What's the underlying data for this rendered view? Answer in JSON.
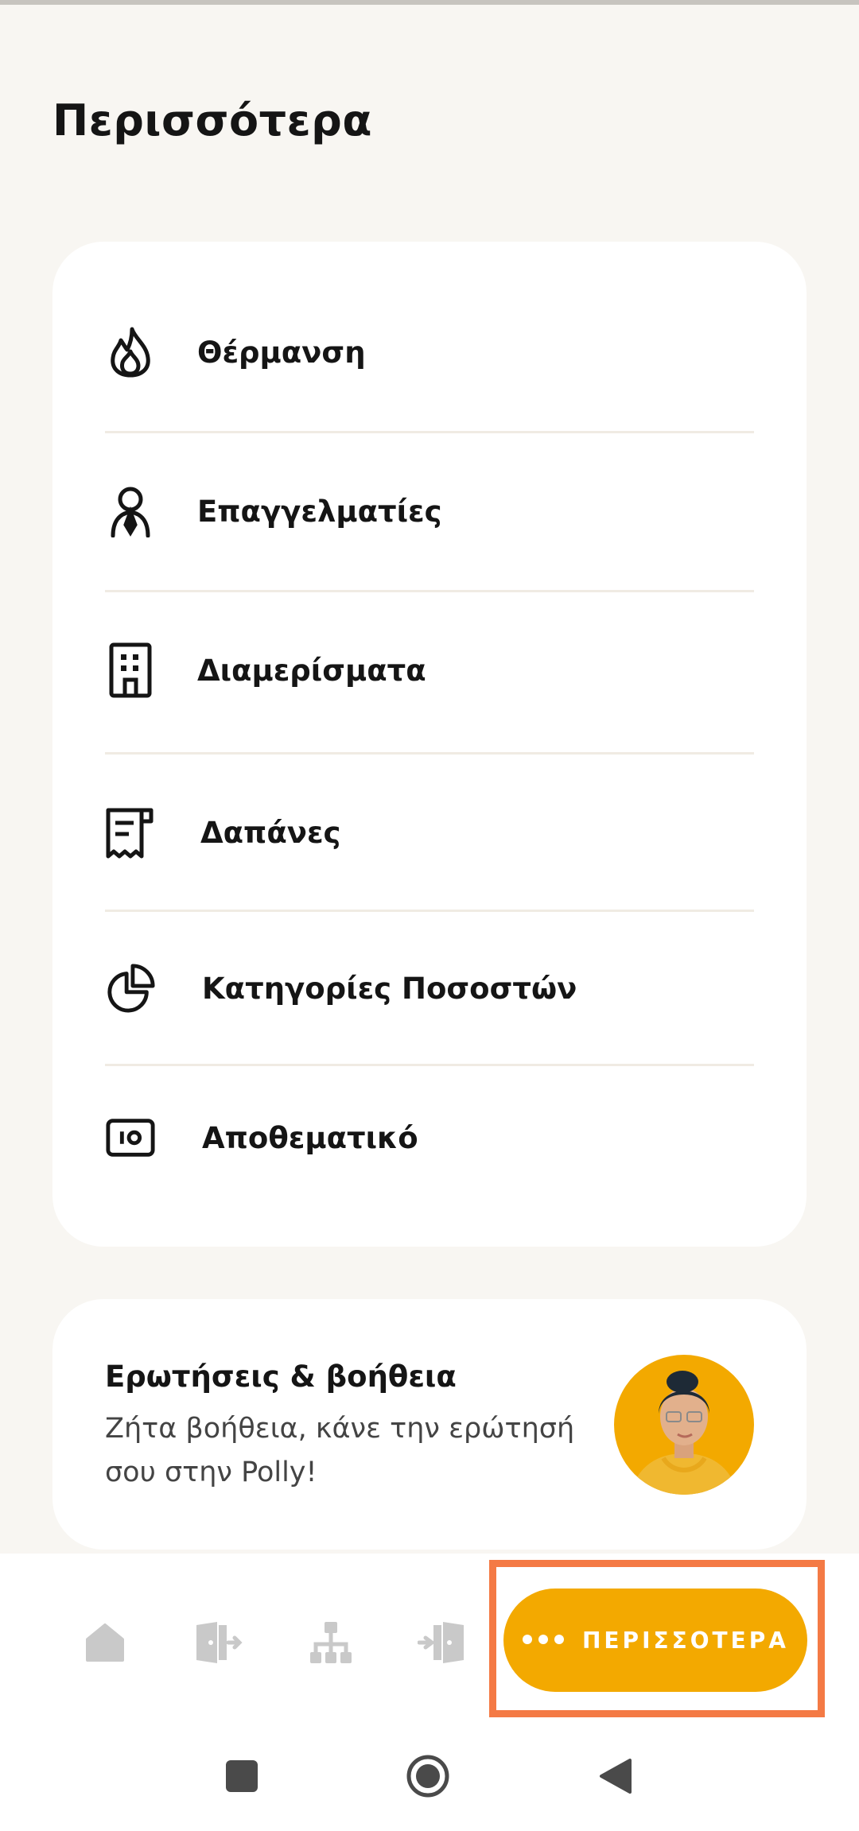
{
  "page": {
    "title": "Περισσότερα"
  },
  "menu": {
    "items": [
      {
        "label": "Θέρμανση",
        "icon": "flame-icon"
      },
      {
        "label": "Επαγγελματίες",
        "icon": "professional-icon"
      },
      {
        "label": "Διαμερίσματα",
        "icon": "building-icon"
      },
      {
        "label": "Δαπάνες",
        "icon": "receipt-icon"
      },
      {
        "label": "Κατηγορίες Ποσοστών",
        "icon": "pie-chart-icon"
      },
      {
        "label": "Αποθεματικό",
        "icon": "reserve-icon"
      }
    ]
  },
  "help": {
    "title": "Ερωτήσεις & βοήθεια",
    "text": "Ζήτα βοήθεια, κάνε την ερώτησή σου στην Polly!",
    "avatar": "polly-avatar"
  },
  "bottom_nav": {
    "items": [
      "home-icon",
      "door-exit-icon",
      "hierarchy-icon",
      "door-enter-icon"
    ],
    "more_label": "ΠΕΡΙΣΣΟΤΕΡΑ",
    "accent": "#f3a900",
    "highlight_color": "#f47a45"
  },
  "system_nav": [
    "recent-apps-icon",
    "home-circle-icon",
    "back-icon"
  ]
}
